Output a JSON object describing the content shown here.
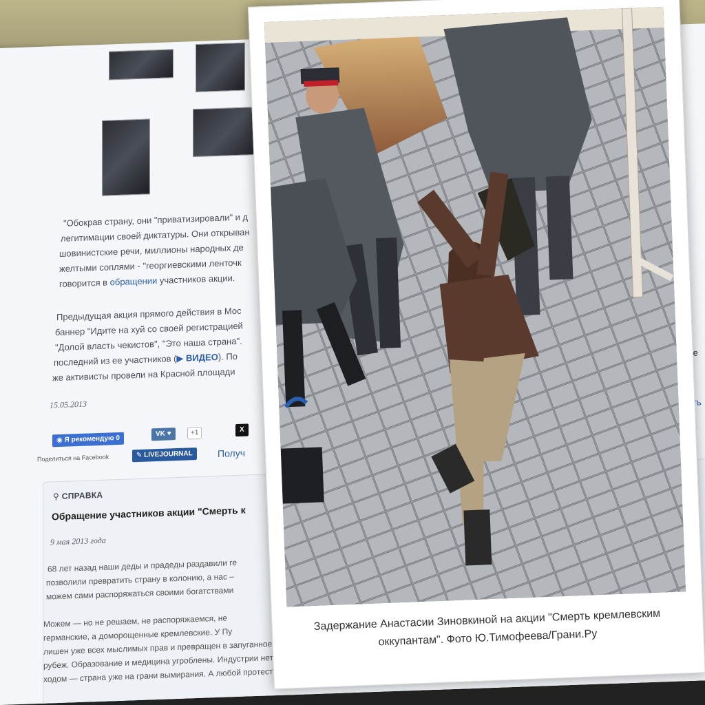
{
  "article": {
    "quote_lines": [
      "\"Обокрав страну, они \"приватизировали\" и д",
      "легитимации своей диктатуры. Они открыван",
      "шовинистские речи, миллионы народных де",
      "желтыми соплями - \"георгиевскими ленточк"
    ],
    "quote_tail_prefix": "говорится в ",
    "quote_tail_link": "обращении",
    "quote_tail_suffix": " участников акции.",
    "previous_lines": [
      "Предыдущая акция прямого действия в Мос",
      "баннер \"Идите на хуй со своей регистрацией",
      "\"Долой власть чекистов\", \"Это наша страна\"."
    ],
    "previous_line4_prefix": "последний из ее участников (",
    "previous_line4_link": "ВИДЕО",
    "previous_line4_suffix": "). По",
    "previous_line5": "же активисты провели на Красной площади",
    "date": "15.05.2013",
    "right_edge_te": "е те",
    "right_edge_link": "адить"
  },
  "share": {
    "facebook_label": "Я рекомендую 0",
    "facebook_caption": "Поделиться на Facebook",
    "vk_label": "VK",
    "vk_count": "+1",
    "x_label": "X",
    "lj_label": "LIVEJOURNAL",
    "get_link": "Получ"
  },
  "reference": {
    "heading": "СПРАВКА",
    "title": "Обращение участников акции \"Смерть к",
    "date": "9 мая 2013 года",
    "para1_lines": [
      "68 лет назад наши деды и прадеды раздавили ге",
      "позволили превратить страну в колонию, а нас –",
      "можем сами распоряжаться своими богатствами"
    ],
    "para2_lines": [
      "Можем — но не решаем, не распоряжаемся, не",
      "германские, а доморощенные кремлевские. У Пу",
      "лишен уже всех мыслимых прав и превращен в запуганное послушное стадо. Наши с вами богатства нагло разграбляют и прод",
      "рубеж. Образование и медицина угроблены. Индустрии нет. Культуру душат. Лучшие учены",
      "ходом — страна уже на грани вымирания. А любой протест"
    ]
  },
  "lightbox": {
    "caption_line1": "Задержание Анастасии Зиновкиной на акции \"Смерть кремлевским",
    "caption_line2": "оккупантам\". Фото Ю.Тимофеева/Грани.Ру"
  }
}
